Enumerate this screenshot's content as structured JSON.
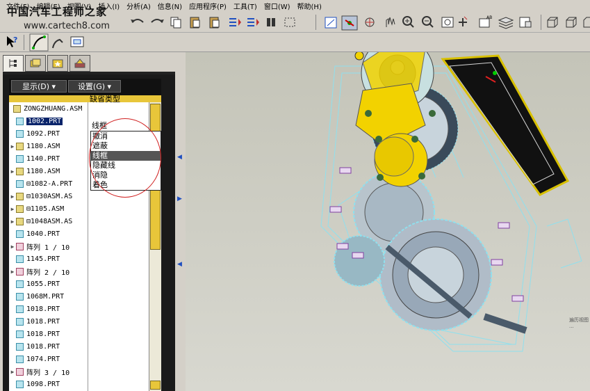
{
  "menu": [
    "文件(F)",
    "编辑(E)",
    "视图(V)",
    "插入(I)",
    "分析(A)",
    "信息(N)",
    "应用程序(P)",
    "工具(T)",
    "窗口(W)",
    "帮助(H)"
  ],
  "watermark": {
    "title": "中国汽车工程师之家",
    "url": "www.cartech8.com"
  },
  "panel": {
    "display_button": "显示(D) ▾",
    "settings_button": "设置(G) ▾",
    "column_header": "缺省类型",
    "root_label": "ZONGZHUANG.ASM",
    "cell_value": "线框",
    "items": [
      {
        "label": "1002.PRT",
        "type": "part",
        "expand": "",
        "selected": true
      },
      {
        "label": "1092.PRT",
        "type": "part",
        "expand": ""
      },
      {
        "label": "1180.ASM",
        "type": "asm",
        "expand": "▶"
      },
      {
        "label": "1140.PRT",
        "type": "part",
        "expand": ""
      },
      {
        "label": "1180.ASM",
        "type": "asm",
        "expand": "▶"
      },
      {
        "label": "⊟1082-A.PRT",
        "type": "part",
        "expand": ""
      },
      {
        "label": "⊟1030ASM.AS",
        "type": "asm",
        "expand": "▶"
      },
      {
        "label": "⊟1105.ASM",
        "type": "asm",
        "expand": "▶"
      },
      {
        "label": "⊟1048ASM.AS",
        "type": "asm",
        "expand": "▶"
      },
      {
        "label": "1040.PRT",
        "type": "part",
        "expand": ""
      },
      {
        "label": "阵列 1 / 10",
        "type": "pattern",
        "expand": "▶"
      },
      {
        "label": "1145.PRT",
        "type": "part",
        "expand": ""
      },
      {
        "label": "阵列 2 / 10",
        "type": "pattern",
        "expand": "▶"
      },
      {
        "label": "1055.PRT",
        "type": "part",
        "expand": ""
      },
      {
        "label": "1068M.PRT",
        "type": "part",
        "expand": ""
      },
      {
        "label": "1018.PRT",
        "type": "part",
        "expand": ""
      },
      {
        "label": "1018.PRT",
        "type": "part",
        "expand": ""
      },
      {
        "label": "1018.PRT",
        "type": "part",
        "expand": ""
      },
      {
        "label": "1018.PRT",
        "type": "part",
        "expand": ""
      },
      {
        "label": "1074.PRT",
        "type": "part",
        "expand": ""
      },
      {
        "label": "阵列 3 / 10",
        "type": "pattern",
        "expand": "▶"
      },
      {
        "label": "1098.PRT",
        "type": "part",
        "expand": ""
      }
    ],
    "dropdown": [
      "撤消",
      "遮蔽",
      "线框",
      "隐藏线",
      "消隐",
      "着色"
    ],
    "dropdown_highlight_index": 2
  },
  "viewport": {
    "corner_text": "遍历视图 ..."
  },
  "colors": {
    "accent_yellow": "#e8c63a",
    "panel_dark": "#1a1a1a",
    "wire_cyan": "#8fe0ee",
    "part_yellow": "#f2d200"
  }
}
